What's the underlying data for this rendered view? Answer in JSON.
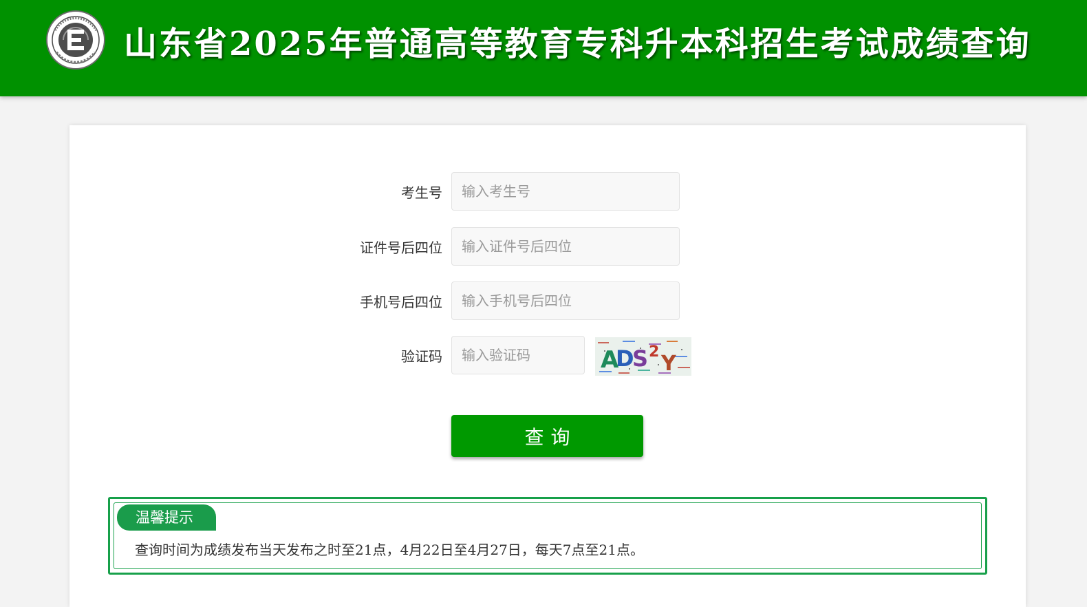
{
  "header": {
    "title": "山东省2025年普通高等教育专科升本科招生考试成绩查询",
    "logo_letter": "E",
    "background_color": "#009100"
  },
  "form": {
    "fields": [
      {
        "label": "考生号",
        "placeholder": "输入考生号",
        "value": ""
      },
      {
        "label": "证件号后四位",
        "placeholder": "输入证件号后四位",
        "value": ""
      },
      {
        "label": "手机号后四位",
        "placeholder": "输入手机号后四位",
        "value": ""
      },
      {
        "label": "验证码",
        "placeholder": "输入验证码",
        "value": ""
      }
    ],
    "captcha_text": "ADS2Y",
    "submit_label": "查询",
    "accent_color": "#009900"
  },
  "tips": {
    "title": "温馨提示",
    "text": "查询时间为成绩发布当天发布之时至21点，4月22日至4月27日，每天7点至21点。",
    "border_color": "#17a04a"
  }
}
